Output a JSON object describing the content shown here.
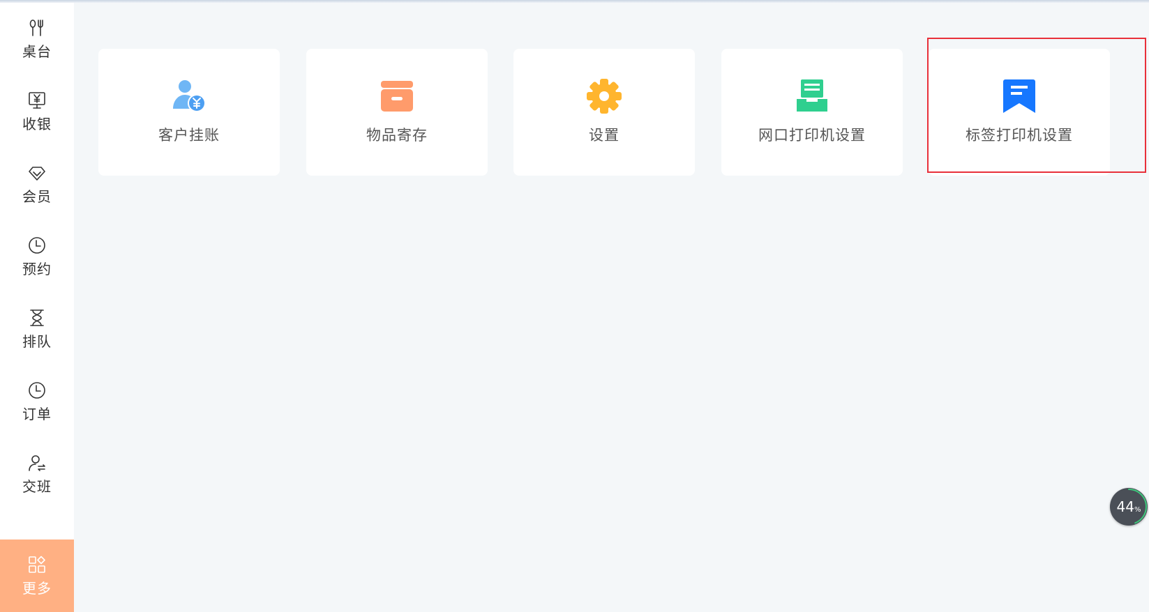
{
  "sidebar": {
    "items": [
      {
        "label": "桌台",
        "icon": "fork-knife-icon",
        "active": false
      },
      {
        "label": "收银",
        "icon": "cashier-monitor-icon",
        "active": false
      },
      {
        "label": "会员",
        "icon": "diamond-icon",
        "active": false
      },
      {
        "label": "预约",
        "icon": "clock-icon",
        "active": false
      },
      {
        "label": "排队",
        "icon": "hourglass-icon",
        "active": false
      },
      {
        "label": "订单",
        "icon": "clock-icon",
        "active": false
      },
      {
        "label": "交班",
        "icon": "user-swap-icon",
        "active": false
      },
      {
        "label": "更多",
        "icon": "grid-more-icon",
        "active": true
      }
    ]
  },
  "main": {
    "cards": [
      {
        "label": "客户挂账",
        "icon": "customer-credit-icon",
        "color": "#6fb6f5"
      },
      {
        "label": "物品寄存",
        "icon": "storage-box-icon",
        "color": "#ff9b6b"
      },
      {
        "label": "设置",
        "icon": "gear-icon",
        "color": "#ffb52e"
      },
      {
        "label": "网口打印机设置",
        "icon": "network-printer-icon",
        "color": "#2fcf8f"
      },
      {
        "label": "标签打印机设置",
        "icon": "label-bookmark-icon",
        "color": "#1677ff"
      }
    ]
  },
  "progress": {
    "value": "44",
    "unit": "%",
    "fraction": 0.44
  },
  "colors": {
    "sidebar_active": "#ffb083",
    "highlight": "#e8303a",
    "background": "#f4f7f9"
  }
}
